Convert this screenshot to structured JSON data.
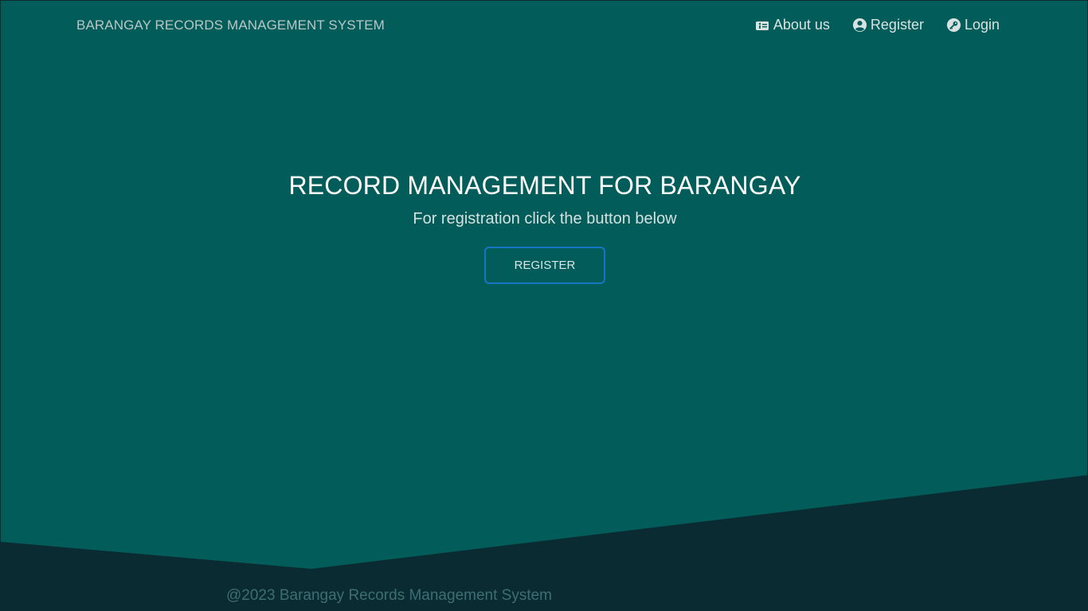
{
  "navbar": {
    "brand": "BARANGAY RECORDS MANAGEMENT SYSTEM",
    "links": [
      {
        "label": "About us",
        "icon": "info-card-icon"
      },
      {
        "label": "Register",
        "icon": "user-circle-icon"
      },
      {
        "label": "Login",
        "icon": "key-icon"
      }
    ]
  },
  "hero": {
    "title": "RECORD MANAGEMENT FOR BARANGAY",
    "subtitle": "For registration click the button below",
    "button_label": "REGISTER"
  },
  "footer": {
    "text": "@2023 Barangay Records Management System"
  },
  "colors": {
    "background": "#025d5a",
    "wave_dark": "#0b2b32",
    "button_border": "#1575c4"
  }
}
